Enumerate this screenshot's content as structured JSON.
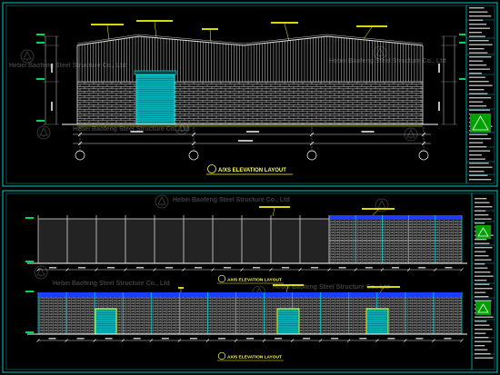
{
  "drawing": {
    "top_sheet": {
      "view_title": "A/XS ELEVATION LAYOUT"
    },
    "bottom_sheet": {
      "view_title_1": "AXIS ELEVATION LAYOUT",
      "view_title_2": "AXIS ELEVATION LAYOUT"
    }
  },
  "watermark": {
    "company_en": "Hebei Baofeng Steel Structure Co., Ltd",
    "company_cn": "河北宝丰钢结构有限公司"
  },
  "colors": {
    "frame": "#00c8c8",
    "line": "#d8d8d8",
    "brick": "#a8a8a8",
    "roof_band": "#1f3bff",
    "door": "#00b4bc",
    "door_slat": "#006a70",
    "column": "#00e0e0",
    "leader_label": "#ffff00",
    "level_label": "#00ff66",
    "logo": "#00a000"
  },
  "icons": [
    "company-logo-icon",
    "grid-bubble-icon",
    "roller-door"
  ]
}
